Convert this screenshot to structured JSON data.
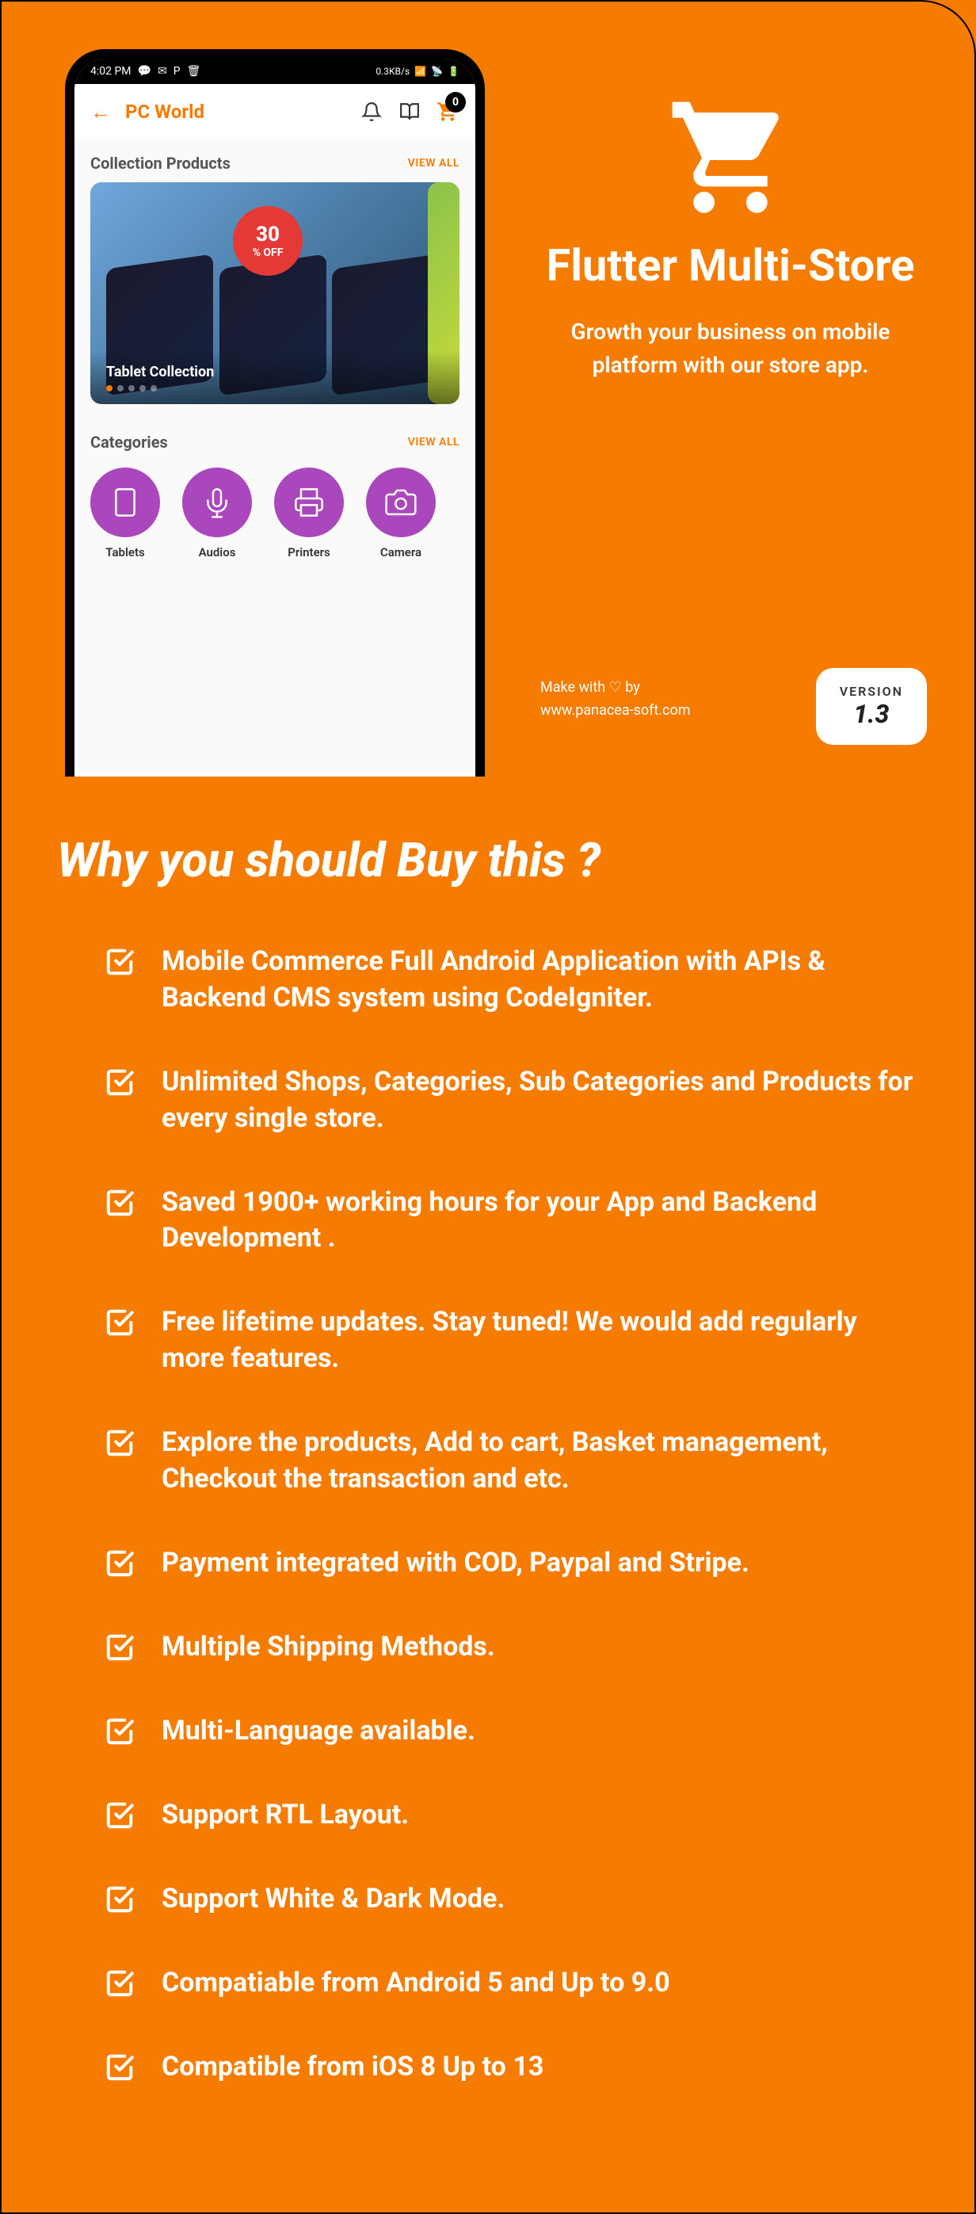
{
  "hero": {
    "title": "Flutter Multi-Store",
    "subtitle": "Growth your business on mobile platform with our store app.",
    "credit_prefix": "Make with",
    "credit_suffix": "by",
    "credit_url": "www.panacea-soft.com",
    "version_label": "VERSION",
    "version_number": "1.3"
  },
  "phone": {
    "status_time": "4:02 PM",
    "status_net": "0.3KB/s",
    "appbar_title": "PC World",
    "cart_count": "0",
    "collection_title": "Collection Products",
    "collection_viewall": "VIEW ALL",
    "carousel_caption": "Tablet Collection",
    "discount_number": "30",
    "discount_text": "% OFF",
    "categories_title": "Categories",
    "categories_viewall": "VIEW ALL",
    "categories": [
      "Tablets",
      "Audios",
      "Printers",
      "Camera"
    ]
  },
  "why_title": "Why you should Buy this ?",
  "features": [
    "Mobile Commerce Full Android Application with APIs & Backend CMS system using CodeIgniter.",
    "Unlimited Shops, Categories, Sub Categories and Products for every single store.",
    "Saved 1900+ working hours for your App and Backend Development .",
    "Free lifetime updates. Stay tuned! We would add regularly more features.",
    "Explore the products, Add to cart, Basket management, Checkout the transaction and etc.",
    "Payment integrated with COD, Paypal and Stripe.",
    "Multiple Shipping Methods.",
    "Multi-Language available.",
    "Support RTL Layout.",
    "Support White & Dark Mode.",
    "Compatiable from Android 5 and Up to 9.0",
    "Compatible from iOS 8 Up to 13"
  ]
}
